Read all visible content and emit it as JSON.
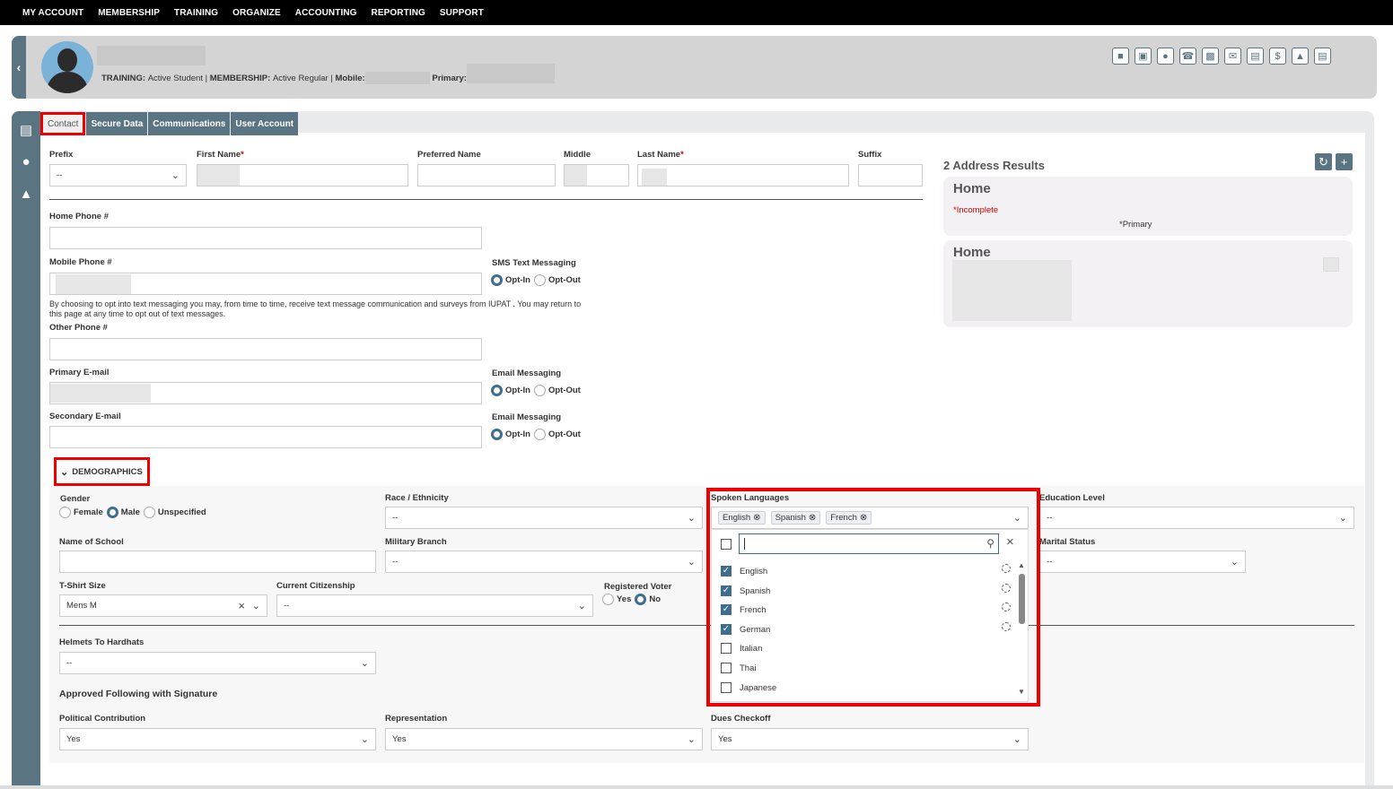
{
  "topnav": [
    "MY ACCOUNT",
    "MEMBERSHIP",
    "TRAINING",
    "ORGANIZE",
    "ACCOUNTING",
    "REPORTING",
    "SUPPORT"
  ],
  "header": {
    "training_label": "TRAINING:",
    "training_value": "Active Student",
    "membership_label": "MEMBERSHIP:",
    "membership_value": "Active Regular",
    "mobile_label": "Mobile:",
    "primary_label": "Primary:",
    "sep": "|",
    "back_icon": "chevron-left-icon",
    "action_icons": [
      "badge-icon",
      "id-card-icon",
      "user-icon",
      "phone-icon",
      "chat-icon",
      "message-icon",
      "document-icon",
      "dollar-icon",
      "megaphone-icon",
      "contact-card-icon"
    ]
  },
  "tabs": [
    "Contact",
    "Secure Data",
    "Communications",
    "User Account"
  ],
  "name_fields": {
    "prefix_label": "Prefix",
    "prefix_value": "--",
    "first_label": "First Name",
    "preferred_label": "Preferred Name",
    "middle_label": "Middle",
    "last_label": "Last Name",
    "suffix_label": "Suffix",
    "required_mark": "*"
  },
  "phones": {
    "home_label": "Home Phone #",
    "mobile_label": "Mobile Phone #",
    "other_label": "Other Phone #",
    "sms_label": "SMS Text Messaging",
    "opt_in": "Opt-In",
    "opt_out": "Opt-Out",
    "disclaimer_1": "By choosing to opt into text messaging you may, from time to time, receive text message communication and surveys from IUPAT . You may return to",
    "disclaimer_2": "this page at any time to opt out of text messages."
  },
  "emails": {
    "primary_label": "Primary E-mail",
    "secondary_label": "Secondary E-mail",
    "messaging_label": "Email Messaging"
  },
  "address": {
    "title": "2 Address Results",
    "cards": [
      {
        "title": "Home",
        "incomplete": "*Incomplete",
        "primary": "*Primary"
      },
      {
        "title": "Home"
      }
    ]
  },
  "demographics": {
    "title": "DEMOGRAPHICS",
    "gender_label": "Gender",
    "gender_options": [
      "Female",
      "Male",
      "Unspecified"
    ],
    "gender_selected": "Male",
    "race_label": "Race / Ethnicity",
    "race_value": "--",
    "spoken_label": "Spoken Languages",
    "spoken_tags": [
      "English",
      "Spanish",
      "French"
    ],
    "education_label": "Education Level",
    "education_value": "--",
    "school_label": "Name of School",
    "military_label": "Military Branch",
    "military_value": "--",
    "marital_label": "Marital Status",
    "marital_value": "--",
    "tshirt_label": "T-Shirt Size",
    "tshirt_value": "Mens M",
    "citizenship_label": "Current Citizenship",
    "citizenship_value": "--",
    "voter_label": "Registered Voter",
    "voter_yes": "Yes",
    "voter_no": "No",
    "helmets_label": "Helmets To Hardhats",
    "helmets_value": "--",
    "approved_heading": "Approved Following with Signature",
    "political_label": "Political Contribution",
    "political_value": "Yes",
    "representation_label": "Representation",
    "representation_value": "Yes",
    "dues_label": "Dues Checkoff",
    "dues_value": "Yes"
  },
  "language_list": [
    {
      "name": "English",
      "checked": true
    },
    {
      "name": "Spanish",
      "checked": true
    },
    {
      "name": "French",
      "checked": true
    },
    {
      "name": "German",
      "checked": true
    },
    {
      "name": "Italian",
      "checked": false
    },
    {
      "name": "Thai",
      "checked": false
    },
    {
      "name": "Japanese",
      "checked": false
    }
  ],
  "colors": {
    "accent": "#5a7482",
    "highlight": "#e00000",
    "radio": "#3e6d8e"
  }
}
